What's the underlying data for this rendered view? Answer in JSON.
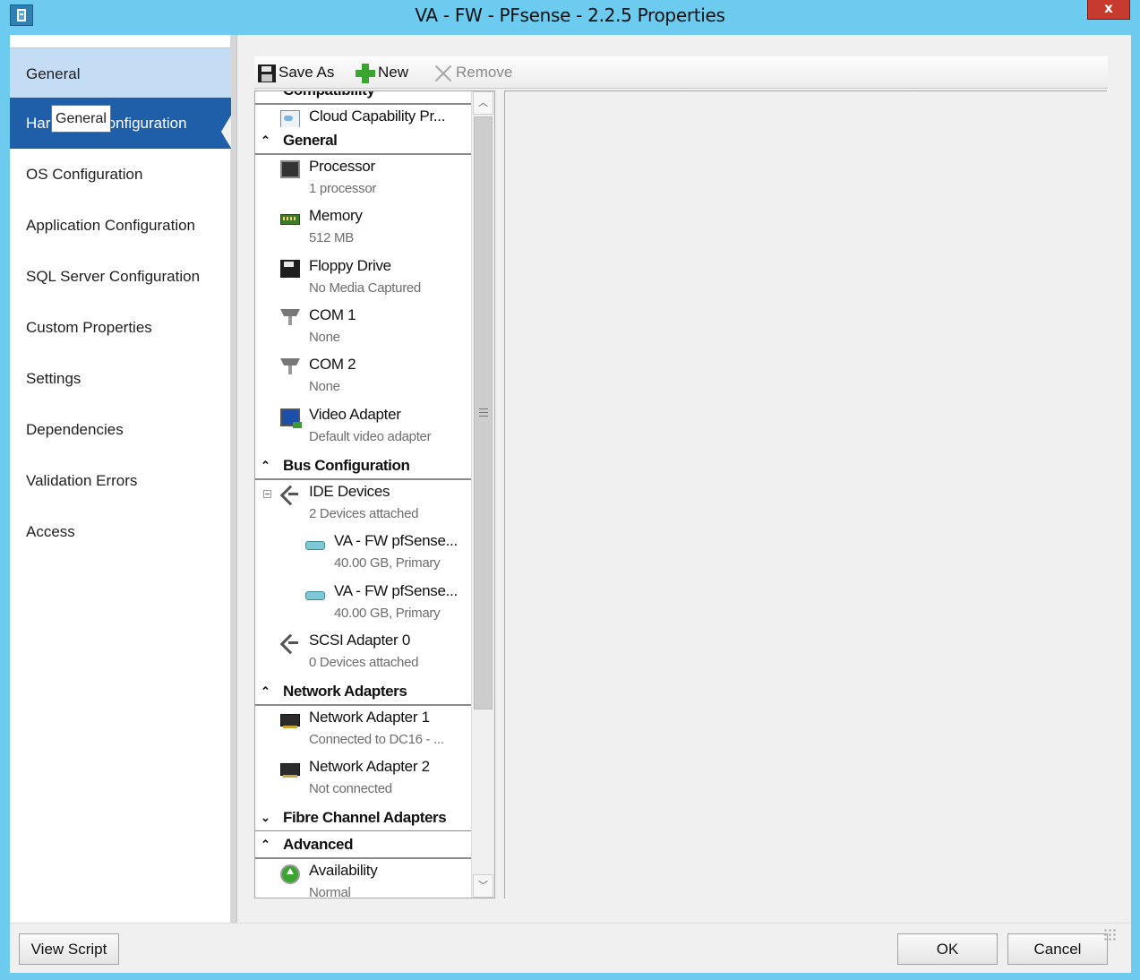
{
  "window": {
    "title": "VA - FW - PFsense - 2.2.5 Properties",
    "close_label": "x"
  },
  "nav": {
    "items": [
      {
        "label": "General",
        "state": "hover"
      },
      {
        "label": "Hardware Configuration",
        "state": "selected"
      },
      {
        "label": "OS Configuration"
      },
      {
        "label": "Application Configuration"
      },
      {
        "label": "SQL Server Configuration"
      },
      {
        "label": "Custom Properties"
      },
      {
        "label": "Settings"
      },
      {
        "label": "Dependencies"
      },
      {
        "label": "Validation Errors"
      },
      {
        "label": "Access"
      }
    ],
    "tooltip": "General"
  },
  "toolbar": {
    "save_as": "Save As",
    "new": "New",
    "remove": "Remove"
  },
  "hardware_list": {
    "sections": {
      "compatibility": "Compatibility",
      "general": "General",
      "bus": "Bus Configuration",
      "network": "Network Adapters",
      "fibre": "Fibre Channel Adapters",
      "advanced": "Advanced"
    },
    "items": {
      "cloud": {
        "title": "Cloud Capability Pr...",
        "sub": ""
      },
      "processor": {
        "title": "Processor",
        "sub": "1 processor"
      },
      "memory": {
        "title": "Memory",
        "sub": "512 MB"
      },
      "floppy": {
        "title": "Floppy Drive",
        "sub": "No Media Captured"
      },
      "com1": {
        "title": "COM 1",
        "sub": "None"
      },
      "com2": {
        "title": "COM 2",
        "sub": "None"
      },
      "video": {
        "title": "Video Adapter",
        "sub": "Default video adapter"
      },
      "ide": {
        "title": "IDE Devices",
        "sub": "2 Devices attached"
      },
      "disk1": {
        "title": "VA - FW pfSense...",
        "sub": "40.00 GB, Primary"
      },
      "disk2": {
        "title": "VA - FW pfSense...",
        "sub": "40.00 GB, Primary"
      },
      "scsi": {
        "title": "SCSI Adapter 0",
        "sub": "0 Devices attached"
      },
      "nic1": {
        "title": "Network Adapter 1",
        "sub": "Connected to DC16 - ..."
      },
      "nic2": {
        "title": "Network Adapter 2",
        "sub": "Not connected"
      },
      "availability": {
        "title": "Availability",
        "sub": "Normal"
      }
    }
  },
  "footer": {
    "view_script": "View Script",
    "ok": "OK",
    "cancel": "Cancel"
  }
}
